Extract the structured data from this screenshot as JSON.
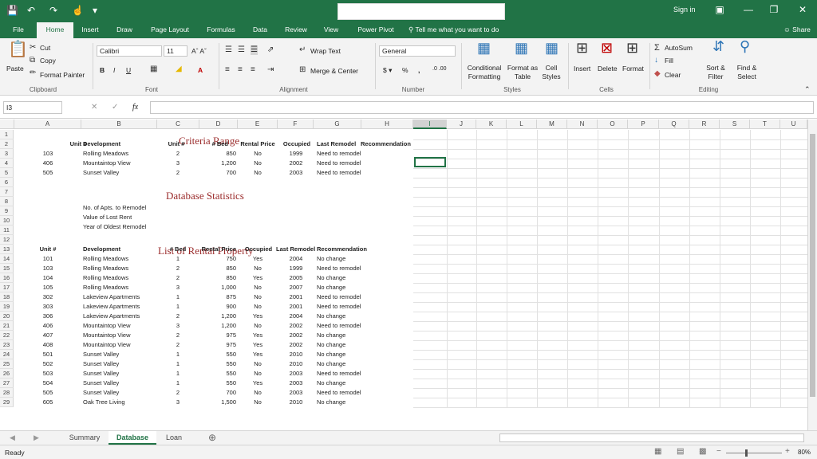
{
  "titlebar": {
    "sign_in": "Sign in"
  },
  "tabs": [
    "File",
    "Home",
    "Insert",
    "Draw",
    "Page Layout",
    "Formulas",
    "Data",
    "Review",
    "View",
    "Power Pivot"
  ],
  "tell_me": "Tell me what you want to do",
  "share": "Share",
  "ribbon": {
    "clipboard": {
      "group": "Clipboard",
      "paste": "Paste",
      "cut": "Cut",
      "copy": "Copy",
      "format_painter": "Format Painter"
    },
    "font": {
      "group": "Font",
      "name": "Calibri",
      "size": "11"
    },
    "alignment": {
      "group": "Alignment",
      "wrap": "Wrap Text",
      "merge": "Merge & Center"
    },
    "number": {
      "group": "Number",
      "format": "General"
    },
    "styles": {
      "group": "Styles",
      "cond": "Conditional Formatting",
      "fmt_table": "Format as Table",
      "cell_styles": "Cell Styles"
    },
    "cells": {
      "group": "Cells",
      "insert": "Insert",
      "delete": "Delete",
      "format": "Format"
    },
    "editing": {
      "group": "Editing",
      "autosum": "AutoSum",
      "fill": "Fill",
      "clear": "Clear",
      "sort": "Sort & Filter",
      "find": "Find & Select"
    }
  },
  "namebox": "I3",
  "columns": [
    "A",
    "B",
    "C",
    "D",
    "E",
    "F",
    "G",
    "H",
    "I",
    "J",
    "K",
    "L",
    "M",
    "N",
    "O",
    "P",
    "Q",
    "R",
    "S",
    "T",
    "U"
  ],
  "rows": [
    "1",
    "2",
    "3",
    "4",
    "5",
    "6",
    "7",
    "8",
    "9",
    "10",
    "11",
    "12",
    "13",
    "14",
    "15",
    "16",
    "17",
    "18",
    "19",
    "20",
    "21",
    "22",
    "23",
    "24",
    "25",
    "26",
    "27",
    "28",
    "29"
  ],
  "sheet": {
    "criteria_title": "Criteria Range",
    "criteria_headers": [
      "Unit #",
      "Development",
      "Unit #",
      "# Bed",
      "Rental Price",
      "Occupied",
      "Last Remodel",
      "Recommendation"
    ],
    "criteria_rows": [
      [
        "103",
        "Rolling Meadows",
        "2",
        "850",
        "No",
        "1999",
        "Need to remodel"
      ],
      [
        "406",
        "Mountaintop View",
        "3",
        "1,200",
        "No",
        "2002",
        "Need to remodel"
      ],
      [
        "505",
        "Sunset Valley",
        "2",
        "700",
        "No",
        "2003",
        "Need to remodel"
      ]
    ],
    "stats_title": "Database Statistics",
    "stats_labels": [
      "No. of Apts. to Remodel",
      "Value of Lost Rent",
      "Year of Oldest Remodel"
    ],
    "list_title": "List of Rental Property",
    "list_headers": [
      "Unit #",
      "Development",
      "# Bed",
      "Rental Price",
      "Occupied",
      "Last Remodel",
      "Recommendation"
    ],
    "list_rows": [
      [
        "101",
        "Rolling Meadows",
        "1",
        "750",
        "Yes",
        "2004",
        "No change"
      ],
      [
        "103",
        "Rolling Meadows",
        "2",
        "850",
        "No",
        "1999",
        "Need to remodel"
      ],
      [
        "104",
        "Rolling Meadows",
        "2",
        "850",
        "Yes",
        "2005",
        "No change"
      ],
      [
        "105",
        "Rolling Meadows",
        "3",
        "1,000",
        "No",
        "2007",
        "No change"
      ],
      [
        "302",
        "Lakeview Apartments",
        "1",
        "875",
        "No",
        "2001",
        "Need to remodel"
      ],
      [
        "303",
        "Lakeview Apartments",
        "1",
        "900",
        "No",
        "2001",
        "Need to remodel"
      ],
      [
        "306",
        "Lakeview Apartments",
        "2",
        "1,200",
        "Yes",
        "2004",
        "No change"
      ],
      [
        "406",
        "Mountaintop View",
        "3",
        "1,200",
        "No",
        "2002",
        "Need to remodel"
      ],
      [
        "407",
        "Mountaintop View",
        "2",
        "975",
        "Yes",
        "2002",
        "No change"
      ],
      [
        "408",
        "Mountaintop View",
        "2",
        "975",
        "Yes",
        "2002",
        "No change"
      ],
      [
        "501",
        "Sunset Valley",
        "1",
        "550",
        "Yes",
        "2010",
        "No change"
      ],
      [
        "502",
        "Sunset Valley",
        "1",
        "550",
        "No",
        "2010",
        "No change"
      ],
      [
        "503",
        "Sunset Valley",
        "1",
        "550",
        "No",
        "2003",
        "Need to remodel"
      ],
      [
        "504",
        "Sunset Valley",
        "1",
        "550",
        "Yes",
        "2003",
        "No change"
      ],
      [
        "505",
        "Sunset Valley",
        "2",
        "700",
        "No",
        "2003",
        "Need to remodel"
      ],
      [
        "605",
        "Oak Tree Living",
        "3",
        "1,500",
        "No",
        "2010",
        "No change"
      ]
    ]
  },
  "sheet_tabs": [
    "Summary",
    "Database",
    "Loan"
  ],
  "status": {
    "ready": "Ready",
    "zoom": "80%"
  }
}
